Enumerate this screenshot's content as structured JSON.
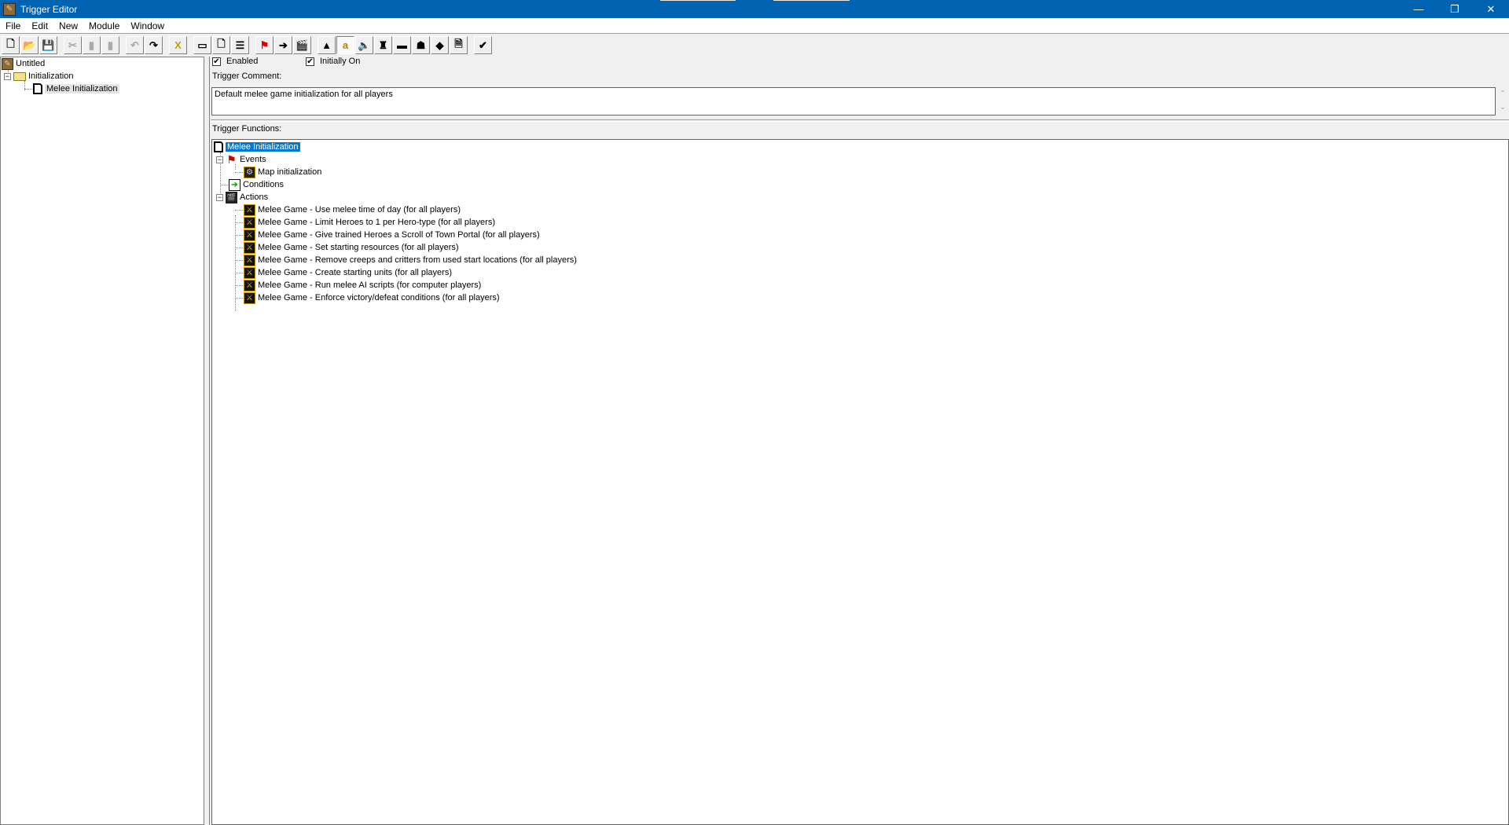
{
  "window": {
    "title": "Trigger Editor",
    "controls": [
      "minimize",
      "restore",
      "close"
    ]
  },
  "menu": [
    "File",
    "Edit",
    "New",
    "Module",
    "Window"
  ],
  "toolbar": [
    {
      "name": "new-map",
      "glyph": "🗋",
      "state": "enabled"
    },
    {
      "name": "open-map",
      "glyph": "📂",
      "state": "enabled"
    },
    {
      "name": "save-map",
      "glyph": "💾",
      "state": "enabled"
    },
    {
      "name": "cut",
      "glyph": "✂",
      "state": "disabled"
    },
    {
      "name": "copy",
      "glyph": "▮",
      "state": "disabled"
    },
    {
      "name": "paste",
      "glyph": "▮",
      "state": "disabled"
    },
    {
      "name": "undo",
      "glyph": "↶",
      "state": "disabled"
    },
    {
      "name": "redo",
      "glyph": "↷",
      "state": "enabled"
    },
    {
      "name": "delete",
      "glyph": "X",
      "state": "enabled"
    },
    {
      "name": "new-category",
      "glyph": "▭",
      "state": "enabled"
    },
    {
      "name": "new-trigger",
      "glyph": "🗋",
      "state": "enabled"
    },
    {
      "name": "new-comment",
      "glyph": "☰",
      "state": "enabled"
    },
    {
      "name": "new-event",
      "glyph": "⚑",
      "state": "enabled"
    },
    {
      "name": "new-condition",
      "glyph": "➔",
      "state": "enabled"
    },
    {
      "name": "new-action",
      "glyph": "🎬",
      "state": "enabled"
    },
    {
      "name": "terrain-editor",
      "glyph": "▲",
      "state": "enabled"
    },
    {
      "name": "trigger-editor",
      "glyph": "a",
      "state": "active"
    },
    {
      "name": "sound-editor",
      "glyph": "🔈",
      "state": "enabled"
    },
    {
      "name": "object-editor",
      "glyph": "♜",
      "state": "enabled"
    },
    {
      "name": "campaign-editor",
      "glyph": "▬",
      "state": "enabled"
    },
    {
      "name": "ai-editor",
      "glyph": "☗",
      "state": "enabled"
    },
    {
      "name": "object-manager",
      "glyph": "◆",
      "state": "enabled"
    },
    {
      "name": "import-manager",
      "glyph": "🗎",
      "state": "enabled"
    },
    {
      "name": "test-map",
      "glyph": "✔",
      "state": "enabled"
    }
  ],
  "triggers_tree": {
    "root": "Untitled",
    "category": "Initialization",
    "trigger": "Melee Initialization"
  },
  "trigger": {
    "enabled_label": "Enabled",
    "enabled": true,
    "initially_on_label": "Initially On",
    "initially_on": true,
    "comment_label": "Trigger Comment:",
    "comment": "Default melee game initialization for all players",
    "functions_label": "Trigger Functions:",
    "name": "Melee Initialization",
    "events_label": "Events",
    "events": [
      "Map initialization"
    ],
    "conditions_label": "Conditions",
    "actions_label": "Actions",
    "actions": [
      "Melee Game - Use melee time of day (for all players)",
      "Melee Game - Limit Heroes to 1 per Hero-type (for all players)",
      "Melee Game - Give trained Heroes a Scroll of Town Portal (for all players)",
      "Melee Game - Set starting resources (for all players)",
      "Melee Game - Remove creeps and critters from used start locations (for all players)",
      "Melee Game - Create starting units (for all players)",
      "Melee Game - Run melee AI scripts (for computer players)",
      "Melee Game - Enforce victory/defeat conditions (for all players)"
    ]
  }
}
